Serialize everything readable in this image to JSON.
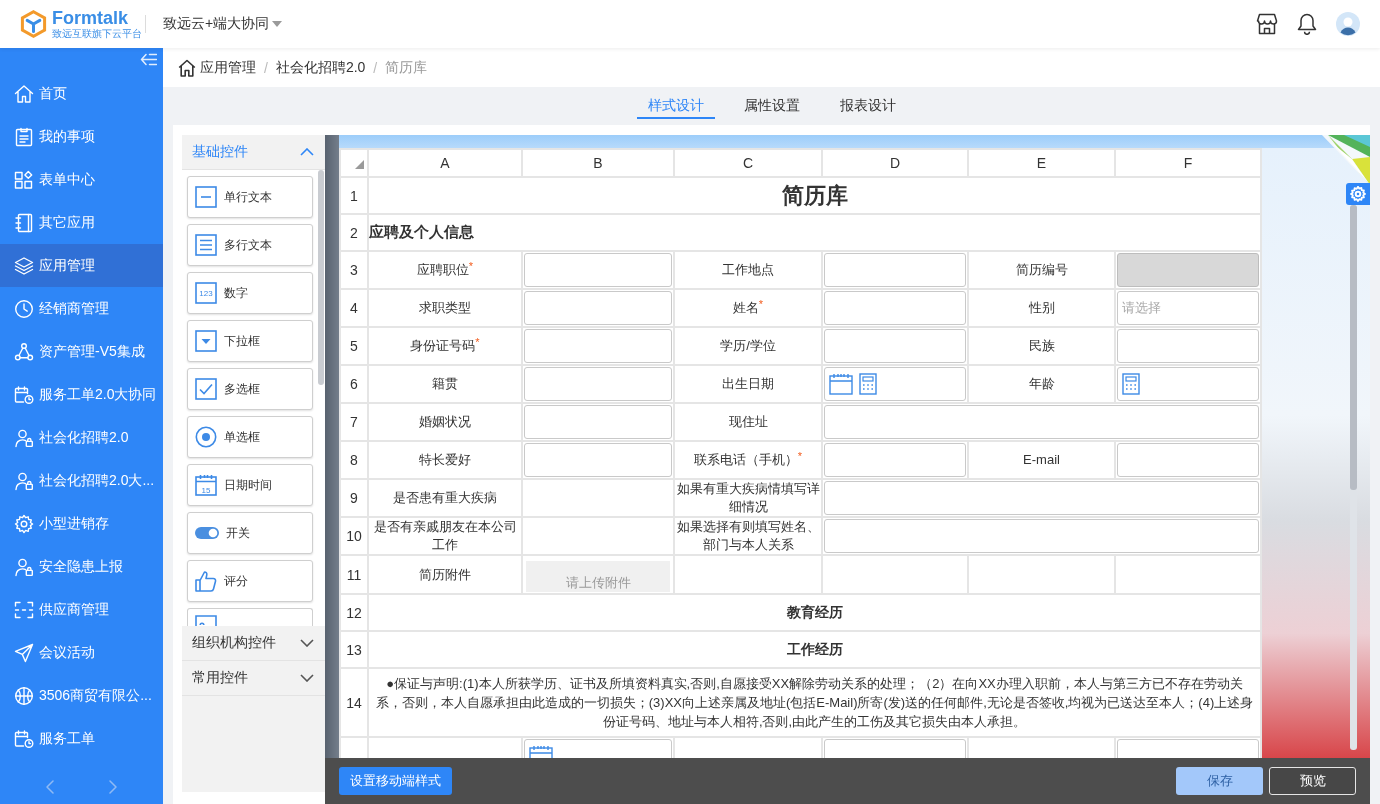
{
  "header": {
    "logo": {
      "name": "Formtalk",
      "tagline": "致远互联旗下云平台"
    },
    "workspace": "致远云+端大协同"
  },
  "sidebar": {
    "items": [
      {
        "label": "首页",
        "selected": false
      },
      {
        "label": "我的事项",
        "selected": false
      },
      {
        "label": "表单中心",
        "selected": false
      },
      {
        "label": "其它应用",
        "selected": false
      },
      {
        "label": "应用管理",
        "selected": true
      },
      {
        "label": "经销商管理",
        "selected": false
      },
      {
        "label": "资产管理-V5集成",
        "selected": false
      },
      {
        "label": "服务工单2.0大协同",
        "selected": false
      },
      {
        "label": "社会化招聘2.0",
        "selected": false
      },
      {
        "label": "社会化招聘2.0大...",
        "selected": false
      },
      {
        "label": "小型进销存",
        "selected": false
      },
      {
        "label": "安全隐患上报",
        "selected": false
      },
      {
        "label": "供应商管理",
        "selected": false
      },
      {
        "label": "会议活动",
        "selected": false
      },
      {
        "label": "3506商贸有限公...",
        "selected": false
      },
      {
        "label": "服务工单",
        "selected": false
      }
    ]
  },
  "breadcrumb": {
    "items": [
      {
        "label": "应用管理",
        "current": false
      },
      {
        "label": "社会化招聘2.0",
        "current": false
      },
      {
        "label": "简历库",
        "current": true
      }
    ],
    "separators": [
      "/",
      "/"
    ]
  },
  "tabs": [
    {
      "label": "样式设计",
      "selected": true
    },
    {
      "label": "属性设置",
      "selected": false
    },
    {
      "label": "报表设计",
      "selected": false
    }
  ],
  "palette": {
    "groups": [
      {
        "title": "基础控件",
        "expanded": true,
        "items": [
          {
            "label": "单行文本"
          },
          {
            "label": "多行文本"
          },
          {
            "label": "数字",
            "icon_text": "123"
          },
          {
            "label": "下拉框"
          },
          {
            "label": "多选框"
          },
          {
            "label": "单选框"
          },
          {
            "label": "日期时间",
            "icon_text": "15"
          },
          {
            "label": "开关"
          },
          {
            "label": "评分"
          },
          {
            "partial": true
          }
        ]
      },
      {
        "title": "组织机构控件",
        "expanded": false
      },
      {
        "title": "常用控件",
        "expanded": false
      }
    ]
  },
  "sheet": {
    "columns": [
      "A",
      "B",
      "C",
      "D",
      "E",
      "F"
    ],
    "rows": [
      {
        "number": "1",
        "cells": [
          {
            "kind": "title",
            "text": "简历库",
            "colspan": 6
          }
        ]
      },
      {
        "number": "2",
        "cells": [
          {
            "kind": "heading",
            "text": "应聘及个人信息",
            "colspan": 6
          }
        ]
      },
      {
        "number": "3",
        "cells": [
          {
            "kind": "label",
            "text": "应聘职位$^{*}$"
          },
          {
            "kind": "input",
            "disabled": false
          },
          {
            "kind": "label",
            "text": "工作地点"
          },
          {
            "kind": "input",
            "disabled": false
          },
          {
            "kind": "label",
            "text": "简历编号"
          },
          {
            "kind": "input",
            "disabled": true
          }
        ]
      },
      {
        "number": "4",
        "cells": [
          {
            "kind": "label",
            "text": "求职类型"
          },
          {
            "kind": "input",
            "disabled": false
          },
          {
            "kind": "label",
            "text": "姓名$^{*}$"
          },
          {
            "kind": "input",
            "disabled": false
          },
          {
            "kind": "label",
            "text": "性别"
          },
          {
            "kind": "select",
            "placeholder": "请选择",
            "disabled": false
          }
        ]
      },
      {
        "number": "5",
        "cells": [
          {
            "kind": "label",
            "text": "身份证号码$^{*}$"
          },
          {
            "kind": "input",
            "disabled": false
          },
          {
            "kind": "label",
            "text": "学历/学位"
          },
          {
            "kind": "input",
            "disabled": false
          },
          {
            "kind": "label",
            "text": "民族"
          },
          {
            "kind": "input",
            "disabled": false
          }
        ]
      },
      {
        "number": "6",
        "cells": [
          {
            "kind": "label",
            "text": "籍贯"
          },
          {
            "kind": "input",
            "disabled": false
          },
          {
            "kind": "label",
            "text": "出生日期"
          },
          {
            "kind": "date_formula",
            "disabled": false
          },
          {
            "kind": "label",
            "text": "年龄"
          },
          {
            "kind": "formula",
            "disabled": false
          }
        ]
      },
      {
        "number": "7",
        "cells": [
          {
            "kind": "label",
            "text": "婚姻状况"
          },
          {
            "kind": "input",
            "disabled": false
          },
          {
            "kind": "label",
            "text": "现住址"
          },
          {
            "kind": "input",
            "disabled": false,
            "colspan": 3
          }
        ]
      },
      {
        "number": "8",
        "cells": [
          {
            "kind": "label",
            "text": "特长爱好"
          },
          {
            "kind": "input",
            "disabled": false
          },
          {
            "kind": "label",
            "text": "联系电话（手机）$^{*}$"
          },
          {
            "kind": "input",
            "disabled": false
          },
          {
            "kind": "label",
            "text": "E-mail"
          },
          {
            "kind": "input",
            "disabled": false
          }
        ]
      },
      {
        "number": "9",
        "cells": [
          {
            "kind": "label",
            "text": "是否患有重大疾病"
          },
          {
            "kind": "blank"
          },
          {
            "kind": "label",
            "text": "如果有重大疾病情填写详细情况"
          },
          {
            "kind": "input",
            "disabled": false,
            "colspan": 3
          }
        ]
      },
      {
        "number": "10",
        "cells": [
          {
            "kind": "label",
            "text": "是否有亲戚朋友在本公司工作"
          },
          {
            "kind": "blank"
          },
          {
            "kind": "label",
            "text": "如果选择有则填写姓名、部门与本人关系"
          },
          {
            "kind": "input",
            "disabled": false,
            "colspan": 3
          }
        ]
      },
      {
        "number": "11",
        "cells": [
          {
            "kind": "label",
            "text": "简历附件"
          },
          {
            "kind": "upload",
            "placeholder": "请上传附件"
          },
          {
            "kind": "blank"
          },
          {
            "kind": "blank"
          },
          {
            "kind": "blank"
          },
          {
            "kind": "blank"
          }
        ]
      },
      {
        "number": "12",
        "cells": [
          {
            "kind": "section",
            "text": "教育经历",
            "colspan": 6
          }
        ]
      },
      {
        "number": "13",
        "cells": [
          {
            "kind": "section",
            "text": "工作经历",
            "colspan": 6
          }
        ]
      },
      {
        "number": "14",
        "cells": [
          {
            "kind": "note",
            "text": "●保证与声明:(1)本人所获学历、证书及所填资料真实,否则,自愿接受XX解除劳动关系的处理；（2）在向XX办理入职前，本人与第三方已不存在劳动关系，否则，本人自愿承担由此造成的一切损失；(3)XX向上述亲属及地址(包括E-Mail)所寄(发)送的任何邮件,无论是否签收,均视为已送达至本人；(4)上述身份证号码、地址与本人相符,否则,由此产生的工伤及其它损失由本人承担。",
            "colspan": 6
          }
        ]
      },
      {
        "cells": [
          {
            "kind": "blank"
          },
          {
            "kind": "date",
            "disabled": false
          },
          {
            "kind": "blank"
          },
          {
            "kind": "input",
            "disabled": false
          },
          {
            "kind": "blank"
          },
          {
            "kind": "input",
            "disabled": false
          }
        ]
      }
    ]
  },
  "footer": {
    "left": [
      {
        "label": "设置移动端样式",
        "kind": "primary",
        "disabled": false
      }
    ],
    "right": [
      {
        "label": "保存",
        "kind": "primary",
        "disabled": true
      },
      {
        "label": "预览",
        "kind": "outline",
        "disabled": false
      }
    ]
  }
}
